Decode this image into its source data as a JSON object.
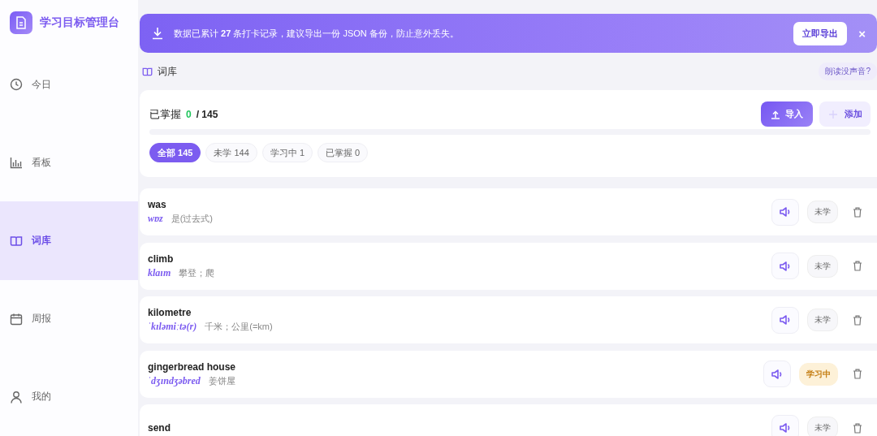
{
  "app": {
    "title": "学习目标管理台"
  },
  "sidebar": {
    "items": [
      {
        "label": "今日",
        "kind": "clock",
        "selected": false
      },
      {
        "label": "看板",
        "kind": "chart",
        "selected": false
      },
      {
        "label": "词库",
        "kind": "book",
        "selected": true
      },
      {
        "label": "周报",
        "kind": "calendar",
        "selected": false
      },
      {
        "label": "我的",
        "kind": "user",
        "selected": false
      }
    ]
  },
  "banner": {
    "text": "数据已累计 **27** 条打卡记录，建议导出一份 JSON 备份，防止意外丢失。",
    "button": "立即导出",
    "close": "×"
  },
  "breadcrumb": {
    "label": "词库",
    "help": "朗读没声音?"
  },
  "summary": {
    "label": "已掌握",
    "mastered": "0",
    "total": "/ 145",
    "level": 0,
    "import": "导入",
    "add": "添加",
    "filters": [
      {
        "label": "全部 145",
        "selected": true
      },
      {
        "label": "未学 144",
        "selected": false
      },
      {
        "label": "学习中 1",
        "selected": false
      },
      {
        "label": "已掌握 0",
        "selected": false
      }
    ]
  },
  "words": [
    {
      "word": "was",
      "phonetic": "wɒz",
      "meaning": "是(过去式)",
      "status": "未学",
      "kind": "new"
    },
    {
      "word": "climb",
      "phonetic": "klaɪm",
      "meaning": "攀登；爬",
      "status": "未学",
      "kind": "new"
    },
    {
      "word": "kilometre",
      "phonetic": "ˈkɪləmiːtə(r)",
      "meaning": "千米；公里(=km)",
      "status": "未学",
      "kind": "new"
    },
    {
      "word": "gingerbread house",
      "phonetic": "ˈdʒɪndʒəbred",
      "meaning": "姜饼屋",
      "status": "学习中",
      "kind": "learning"
    },
    {
      "word": "send",
      "status": "未学",
      "kind": "new"
    }
  ]
}
